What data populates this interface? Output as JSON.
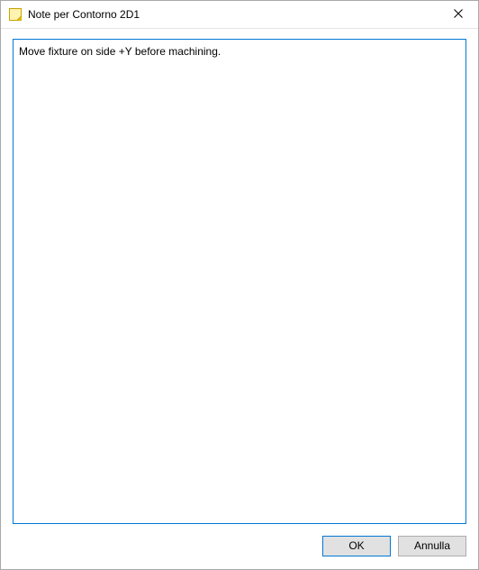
{
  "titlebar": {
    "title": "Note per Contorno 2D1"
  },
  "content": {
    "note_text": "Move fixture on side +Y before machining."
  },
  "buttons": {
    "ok_label": "OK",
    "cancel_label": "Annulla"
  },
  "colors": {
    "accent": "#0078d7"
  }
}
